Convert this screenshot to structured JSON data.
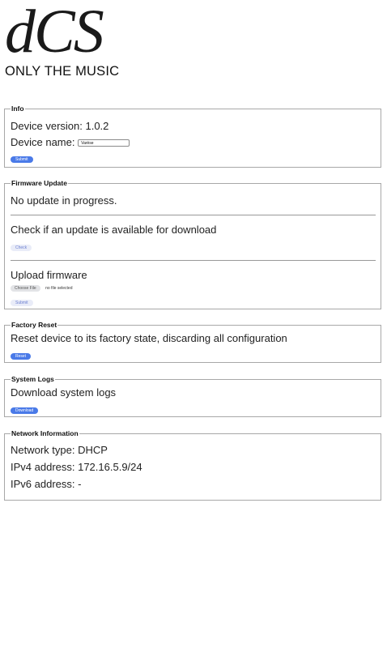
{
  "brand": {
    "logo": "dCS",
    "tagline": "ONLY THE MUSIC"
  },
  "info": {
    "legend": "Info",
    "device_version": "Device version: 1.0.2",
    "device_name_label": "Device name:",
    "device_name_value": "Varèse",
    "submit_label": "Submit"
  },
  "firmware": {
    "legend": "Firmware Update",
    "status": "No update in progress.",
    "check_text": "Check if an update is available for download",
    "check_label": "Check",
    "upload_text": "Upload firmware",
    "choose_file_label": "Choose File",
    "file_status": "no file selected",
    "submit_label": "Submit"
  },
  "factory_reset": {
    "legend": "Factory Reset",
    "description": "Reset device to its factory state, discarding all configuration",
    "reset_label": "Reset"
  },
  "system_logs": {
    "legend": "System Logs",
    "description": "Download system logs",
    "download_label": "Download"
  },
  "network": {
    "legend": "Network Information",
    "network_type": "Network type: DHCP",
    "ipv4": "IPv4 address: 172.16.5.9/24",
    "ipv6": "IPv6 address: -"
  },
  "colors": {
    "primary_button": "#4a7ae8",
    "light_button": "#e9ecf8",
    "border": "#a8a8a8"
  }
}
